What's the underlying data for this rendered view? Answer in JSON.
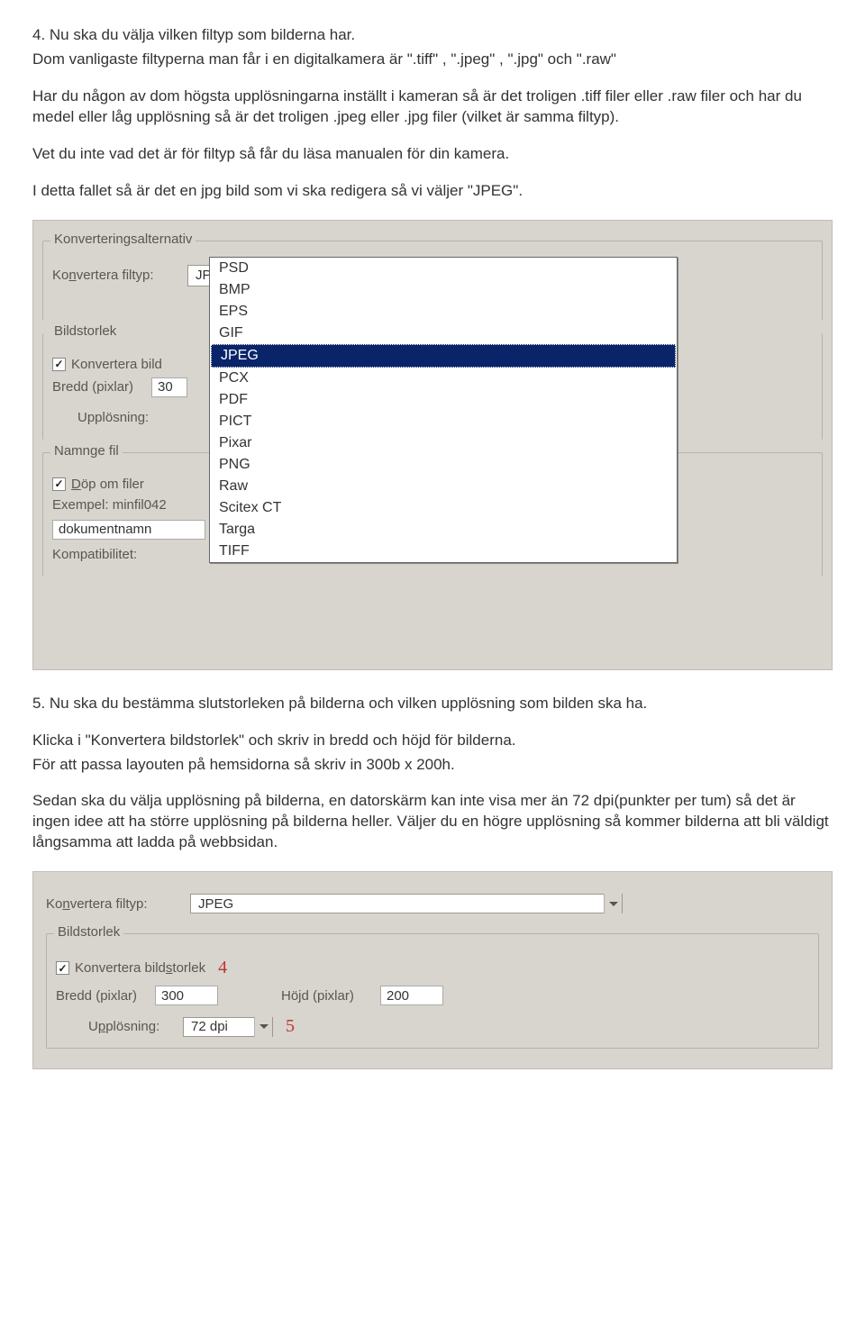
{
  "step4": {
    "p1": "4. Nu ska du välja vilken filtyp som bilderna har.",
    "p2": "Dom vanligaste filtyperna man får i en digitalkamera är \".tiff\" , \".jpeg\" , \".jpg\" och \".raw\"",
    "p3": "Har du någon av dom högsta upplösningarna inställt i kameran så är det troligen .tiff filer eller .raw filer och har du medel eller låg upplösning så är det troligen .jpeg eller .jpg filer (vilket är samma filtyp).",
    "p4": "Vet du inte vad det är för filtyp så får du läsa manualen för din kamera.",
    "p5": "I detta fallet så är det en jpg bild som vi ska redigera så vi väljer \"JPEG\"."
  },
  "dlg1": {
    "grp_conv_title": "Konverteringsalternativ",
    "lbl_conv": "Konvertera filtyp:",
    "combo_conv_val": "JPEG",
    "grp_size_title": "Bildstorlek",
    "chk_conv_size": "Konvertera bild",
    "lbl_width": "Bredd (pixlar)",
    "width_val": "30",
    "lbl_resolution": "Upplösning:",
    "grp_name_title": "Namnge fil",
    "chk_rename": "Döp om filer",
    "lbl_example": "Exempel: minfil042",
    "docname": "dokumentnamn",
    "lbl_compat": "Kompatibilitet:"
  },
  "options": [
    "PSD",
    "BMP",
    "EPS",
    "GIF",
    "JPEG",
    "PCX",
    "PDF",
    "PICT",
    "Pixar",
    "PNG",
    "Raw",
    "Scitex CT",
    "Targa",
    "TIFF"
  ],
  "sel_index": 4,
  "step5": {
    "p1": "5. Nu ska du bestämma slutstorleken på bilderna och vilken upplösning som bilden ska ha.",
    "p2": "Klicka i \"Konvertera bildstorlek\" och skriv in bredd och höjd för bilderna.",
    "p3": "För att passa layouten på hemsidorna så skriv in 300b x 200h.",
    "p4": "Sedan ska du välja upplösning på bilderna, en datorskärm kan inte visa mer än 72 dpi(punkter per tum) så det är ingen idee att ha större upplösning på bilderna heller. Väljer du en högre upplösning så kommer bilderna att bli väldigt långsamma att ladda på webbsidan."
  },
  "dlg2": {
    "lbl_conv": "Konvertera filtyp:",
    "combo_conv_val": "JPEG",
    "grp_size_title": "Bildstorlek",
    "chk_conv_size": "Konvertera bildstorlek",
    "lbl_width": "Bredd (pixlar)",
    "width_val": "300",
    "lbl_height": "Höjd (pixlar)",
    "height_val": "200",
    "lbl_resolution": "Upplösning:",
    "res_val": "72 dpi",
    "mark4": "4",
    "mark5": "5"
  }
}
